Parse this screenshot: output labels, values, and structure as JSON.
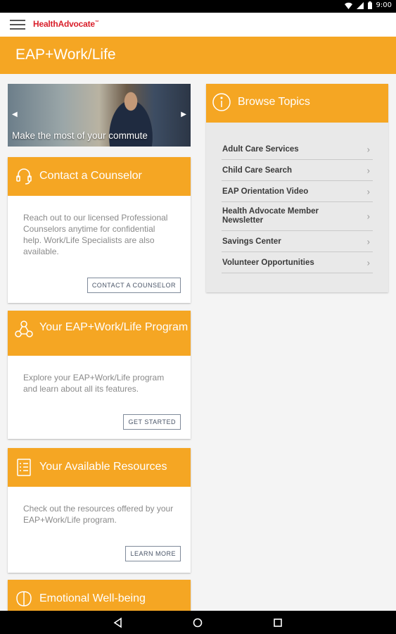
{
  "status_bar": {
    "time": "9:00"
  },
  "app_bar": {
    "logo": "HealthAdvocate",
    "logo_mark": "™"
  },
  "page": {
    "title": "EAP+Work/Life"
  },
  "hero": {
    "caption": "Make the most of your commute",
    "prev_arrow": "◀",
    "next_arrow": "▶"
  },
  "cards": [
    {
      "title": "Contact a Counselor",
      "icon": "headset-icon",
      "text": "Reach out to our licensed Professional Counselors anytime for confidential help. Work/Life Specialists are also available.",
      "button": "CONTACT A COUNSELOR"
    },
    {
      "title": "Your EAP+Work/Life Program",
      "icon": "network-icon",
      "text": "Explore your EAP+Work/Life program and learn about all its features.",
      "button": "GET STARTED"
    },
    {
      "title": "Your Available Resources",
      "icon": "checklist-icon",
      "text": "Check out the resources offered by your EAP+Work/Life program.",
      "button": "LEARN MORE"
    },
    {
      "title": "Emotional Well-being",
      "icon": "brain-icon"
    }
  ],
  "browse": {
    "title": "Browse Topics",
    "icon": "info-icon",
    "topics": [
      "Adult Care Services",
      "Child Care Search",
      "EAP Orientation Video",
      "Health Advocate Member Newsletter",
      "Savings Center",
      "Volunteer Opportunities"
    ],
    "chevron": "›"
  },
  "colors": {
    "accent": "#f5a623",
    "logo_red": "#d91e2a"
  }
}
